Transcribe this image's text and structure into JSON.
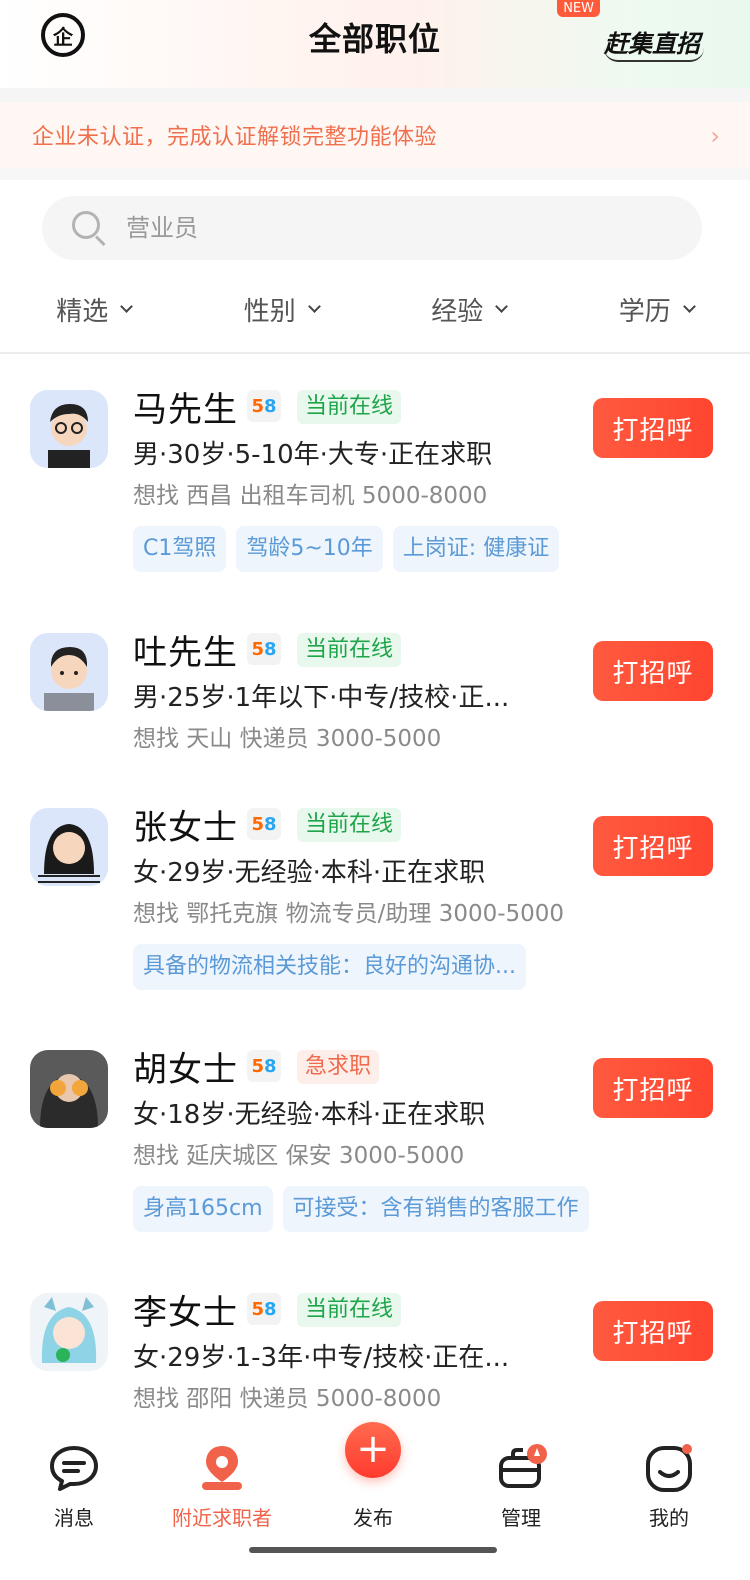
{
  "header": {
    "title": "全部职位",
    "logo_glyph": "企",
    "brand": "赶集直招",
    "new_badge": "NEW"
  },
  "notice": {
    "text": "企业未认证，完成认证解锁完整功能体验",
    "arrow": "›"
  },
  "search": {
    "placeholder": "营业员"
  },
  "filters": [
    {
      "label": "精选"
    },
    {
      "label": "性别"
    },
    {
      "label": "经验"
    },
    {
      "label": "学历"
    }
  ],
  "candidates": [
    {
      "name": "马先生",
      "status": "当前在线",
      "info": "男·30岁·5-10年·大专·正在求职",
      "want": "想找 西昌 出租车司机 5000-8000",
      "tags": [
        "C1驾照",
        "驾龄5~10年",
        "上岗证: 健康证"
      ],
      "action": "打招呼"
    },
    {
      "name": "吐先生",
      "status": "当前在线",
      "info": "男·25岁·1年以下·中专/技校·正...",
      "want": "想找 天山 快递员 3000-5000",
      "tags": [],
      "action": "打招呼"
    },
    {
      "name": "张女士",
      "status": "当前在线",
      "info": "女·29岁·无经验·本科·正在求职",
      "want": "想找 鄂托克旗 物流专员/助理 3000-5000",
      "tags": [
        "具备的物流相关技能：良好的沟通协..."
      ],
      "action": "打招呼"
    },
    {
      "name": "胡女士",
      "status": "急求职",
      "info": "女·18岁·无经验·本科·正在求职",
      "want": "想找 延庆城区 保安 3000-5000",
      "tags": [
        "身高165cm",
        "可接受：含有销售的客服工作"
      ],
      "action": "打招呼"
    },
    {
      "name": "李女士",
      "status": "当前在线",
      "info": "女·29岁·1-3年·中专/技校·正在...",
      "want": "想找 邵阳 快递员 5000-8000",
      "tags": [],
      "action": "打招呼"
    }
  ],
  "bottom_nav": [
    {
      "label": "消息",
      "icon": "message-icon"
    },
    {
      "label": "附近求职者",
      "icon": "location-icon",
      "active": true
    },
    {
      "label": "发布",
      "icon": "plus-icon"
    },
    {
      "label": "管理",
      "icon": "briefcase-icon"
    },
    {
      "label": "我的",
      "icon": "smile-icon"
    }
  ],
  "colors": {
    "accent": "#ff4b33",
    "online": "#1ea54a",
    "tag_text": "#5b9ad6",
    "notice_text": "#f0704e"
  }
}
